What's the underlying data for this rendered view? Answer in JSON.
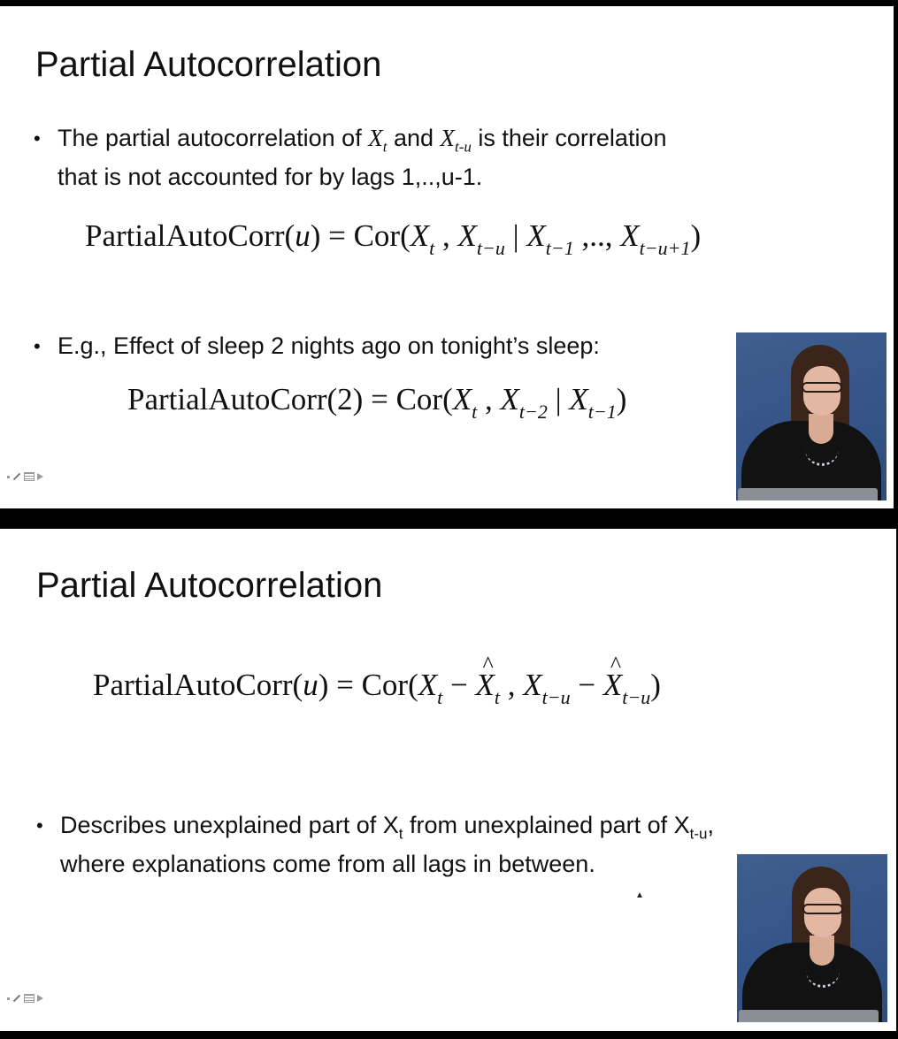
{
  "slide1": {
    "title": "Partial Autocorrelation",
    "bullet1": {
      "t1": "The partial autocorrelation of ",
      "x1": "X",
      "x1_sub": "t",
      "t2": " and ",
      "x2": "X",
      "x2_sub": "t-u",
      "t3": " is their correlation",
      "line2": "that is not accounted for by lags 1,..,u-1."
    },
    "eq1": {
      "lhs": "PartialAutoCorr(",
      "arg": "u",
      "mid": ") = Cor(",
      "a": "X",
      "a_sub": "t",
      "comma1": " , ",
      "b": "X",
      "b_sub": "t−u",
      "bar": " | ",
      "c": "X",
      "c_sub": "t−1",
      "dots": " ,.., ",
      "d": "X",
      "d_sub": "t−u+1",
      "close": ")"
    },
    "bullet2": "E.g., Effect of sleep 2 nights ago on tonight’s sleep:",
    "eq2": {
      "lhs": "PartialAutoCorr(2) = Cor(",
      "a": "X",
      "a_sub": "t",
      "comma": " , ",
      "b": "X",
      "b_sub": "t−2",
      "bar": " | ",
      "c": "X",
      "c_sub": "t−1",
      "close": ")"
    }
  },
  "slide2": {
    "title": "Partial Autocorrelation",
    "eq": {
      "lhs": "PartialAutoCorr(",
      "arg": "u",
      "mid": ") = Cor(",
      "a": "X",
      "a_sub": "t",
      "minus1": " − ",
      "ah": "X",
      "ah_sub": "t",
      "comma": " , ",
      "b": "X",
      "b_sub": "t−u",
      "minus2": " − ",
      "bh": "X",
      "bh_sub": "t−u",
      "close": ")"
    },
    "bullet": {
      "t1": "Describes unexplained part of X",
      "s1": "t",
      "t2": " from unexplained part of X",
      "s2": "t-u",
      "t3": ",",
      "line2": "where explanations come from all lags in between."
    }
  },
  "icons": [
    "nav-square-icon",
    "pen-icon",
    "menu-icon",
    "arrow-right-icon"
  ]
}
